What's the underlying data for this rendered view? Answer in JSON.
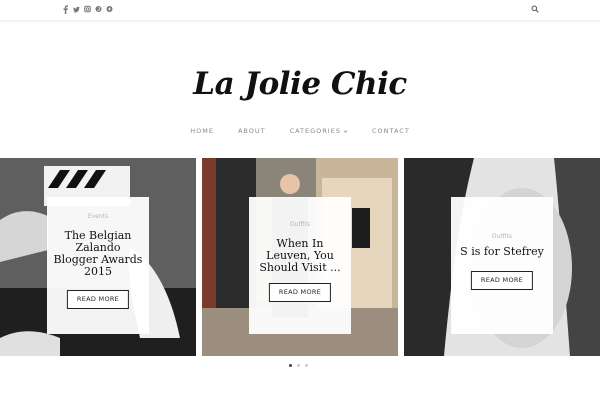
{
  "header": {
    "social": [
      "facebook-icon",
      "twitter-icon",
      "instagram-icon",
      "pinterest-icon",
      "bloglovin-icon"
    ],
    "search_icon": "search-icon"
  },
  "logo": {
    "text": "La Jolie Chic"
  },
  "nav": {
    "items": [
      {
        "label": "HOME"
      },
      {
        "label": "ABOUT"
      },
      {
        "label": "CATEGORIES"
      },
      {
        "label": "CONTACT"
      }
    ]
  },
  "slides": [
    {
      "category": "Events",
      "title": "The Belgian Zalando Blogger Awards 2015",
      "button": "READ MORE"
    },
    {
      "category": "Outfits",
      "title": "When In Leuven, You Should Visit ...",
      "button": "READ MORE"
    },
    {
      "category": "Outfits",
      "title": "S is for Stefrey",
      "button": "READ MORE"
    }
  ],
  "pagination": {
    "count": 3,
    "active": 1
  },
  "colors": {
    "text": "#111111",
    "muted": "#888888",
    "card": "#ffffff"
  }
}
